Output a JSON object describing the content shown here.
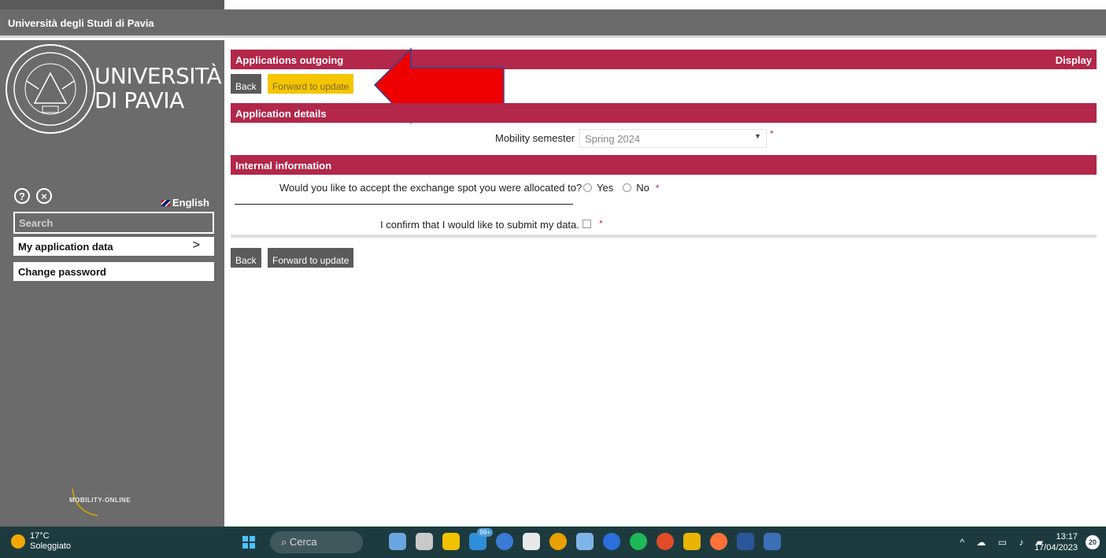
{
  "header": {
    "title": "Università degli Studi di Pavia"
  },
  "sidebar": {
    "logo_line1": "UNIVERSITÀ",
    "logo_line2": "DI PAVIA",
    "help_glyph": "?",
    "close_glyph": "×",
    "language": "English",
    "search_placeholder": "Search",
    "items": [
      {
        "label": "My application data",
        "chevron": ">"
      },
      {
        "label": "Change password"
      }
    ],
    "footer_logo": "MOBILITY-ONLINE"
  },
  "main": {
    "section_title": "Applications outgoing",
    "mode": "Display",
    "back_label": "Back",
    "forward_label": "Forward to update",
    "details_title": "Application details",
    "semester_label": "Mobility semester",
    "semester_value": "Spring 2024",
    "required_mark": "*",
    "internal_title": "Internal information",
    "accept_question": "Would you like to accept the exchange spot you were allocated to?",
    "yes_label": "Yes",
    "no_label": "No",
    "confirm_label": "I confirm that I would like to submit my data."
  },
  "taskbar": {
    "temperature": "17°C",
    "weather": "Soleggiato",
    "search_label": "Cerca",
    "mail_badge": "99+",
    "time": "13:17",
    "date": "17/04/2023",
    "notifications": "20"
  },
  "colors": {
    "accent": "#b2274a",
    "sidebar": "#6b6b6b",
    "highlight": "#f5c500"
  }
}
